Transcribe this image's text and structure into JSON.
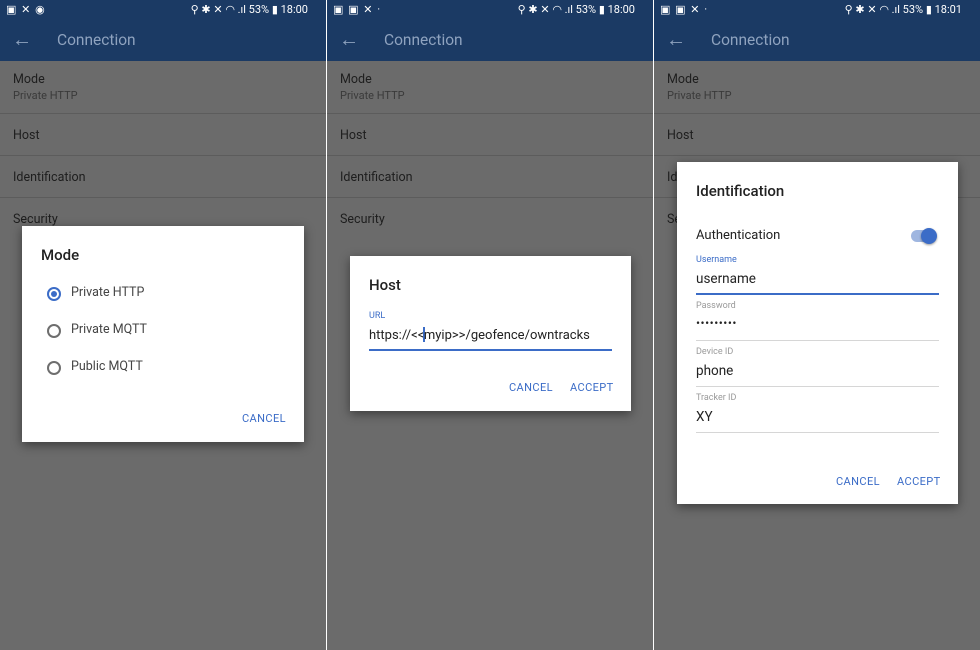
{
  "panels": [
    {
      "status": {
        "left": "▣ ✕ ◉",
        "right": "⚲ ✱ ✕ ◠ .ıl 53% ▮ 18:00"
      },
      "toolbar": {
        "title": "Connection"
      },
      "list": [
        {
          "title": "Mode",
          "subtitle": "Private HTTP"
        },
        {
          "title": "Host"
        },
        {
          "title": "Identification"
        },
        {
          "title": "Security"
        }
      ],
      "dialog": {
        "title": "Mode",
        "options": [
          {
            "label": "Private HTTP",
            "selected": true
          },
          {
            "label": "Private MQTT",
            "selected": false
          },
          {
            "label": "Public MQTT",
            "selected": false
          }
        ],
        "cancel": "CANCEL"
      }
    },
    {
      "status": {
        "left": "▣ ▣ ✕ ·",
        "right": "⚲ ✱ ✕ ◠ .ıl 53% ▮ 18:00"
      },
      "toolbar": {
        "title": "Connection"
      },
      "list": [
        {
          "title": "Mode",
          "subtitle": "Private HTTP"
        },
        {
          "title": "Host"
        },
        {
          "title": "Identification"
        },
        {
          "title": "Security"
        }
      ],
      "dialog": {
        "title": "Host",
        "url_label": "URL",
        "url_before_cursor": "https://<<",
        "url_after_cursor": "myip>>/geofence/owntracks",
        "cancel": "CANCEL",
        "accept": "ACCEPT"
      }
    },
    {
      "status": {
        "left": "▣ ▣ ✕ ·",
        "right": "⚲ ✱ ✕ ◠ .ıl 53% ▮ 18:01"
      },
      "toolbar": {
        "title": "Connection"
      },
      "list": [
        {
          "title": "Mode",
          "subtitle": "Private HTTP"
        },
        {
          "title": "Host"
        },
        {
          "title": "Id"
        },
        {
          "title": "Se"
        }
      ],
      "dialog": {
        "title": "Identification",
        "auth_label": "Authentication",
        "auth_enabled": true,
        "fields": [
          {
            "label": "Username",
            "value": "username"
          },
          {
            "label": "Password",
            "value": "•••••••••"
          },
          {
            "label": "Device ID",
            "value": "phone"
          },
          {
            "label": "Tracker ID",
            "value": "XY"
          }
        ],
        "cancel": "CANCEL",
        "accept": "ACCEPT"
      }
    }
  ],
  "colors": {
    "appbar": "#1b3a64",
    "accent": "#3b6cc7",
    "scrim": "#6b6b6b"
  }
}
